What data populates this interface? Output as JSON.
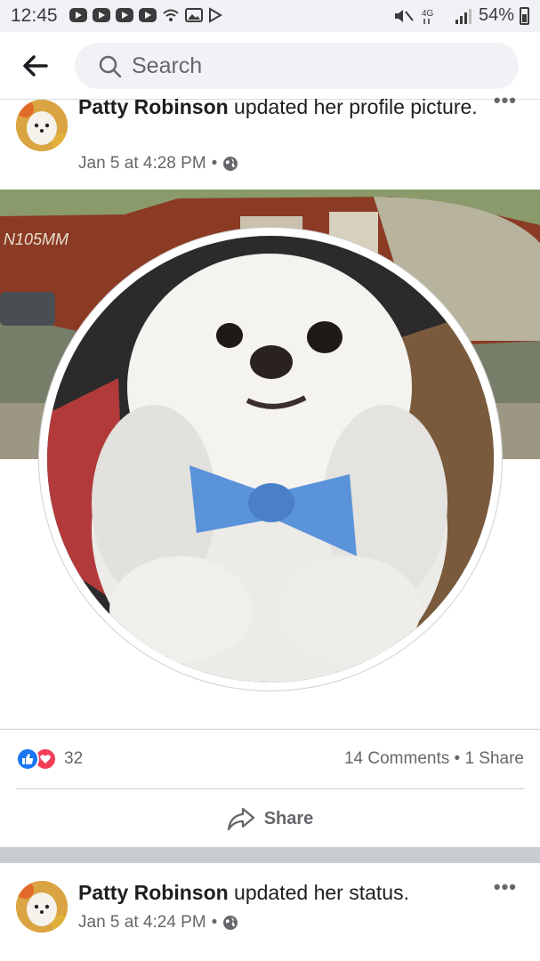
{
  "status_bar": {
    "time": "12:45",
    "battery": "54%",
    "network": "4G"
  },
  "nav": {
    "search_placeholder": "Search"
  },
  "posts": [
    {
      "author": "Patty Robinson",
      "action": " updated her profile picture.",
      "timestamp": "Jan 5 at 4:28 PM",
      "privacy_icon": "globe-icon",
      "reactions": {
        "types": [
          "like",
          "love"
        ],
        "count": "32"
      },
      "stats": "14 Comments • 1 Share",
      "share_label": "Share"
    },
    {
      "author": "Patty Robinson",
      "action": " updated her status.",
      "timestamp": "Jan 5 at 4:24 PM",
      "privacy_icon": "globe-icon"
    }
  ],
  "colors": {
    "facebook_blue": "#1877f2",
    "love_red": "#f33e58",
    "secondary_text": "#65676b",
    "search_bg": "#f0f2f5"
  }
}
